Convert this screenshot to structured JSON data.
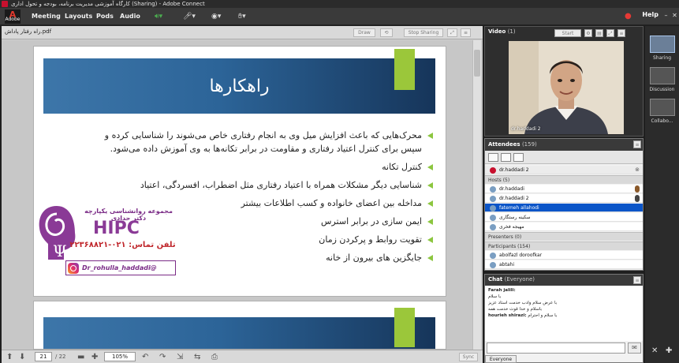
{
  "window": {
    "title": "کارگاه آموزشی مدیریت برنامه، بودجه و تحول اداری (Sharing) - Adobe Connect"
  },
  "menubar": {
    "brand": "Adobe",
    "items": [
      "Meeting",
      "Layouts",
      "Pods",
      "Audio"
    ],
    "help": "Help"
  },
  "share_pod": {
    "document_name": "راه رفتار پاداش.pdf",
    "draw_label": "Draw",
    "stop_sharing_label": "Stop Sharing",
    "page_current": "21",
    "page_total": "/ 22",
    "zoom": "105%",
    "sync_label": "Sync"
  },
  "slide": {
    "title": "راهکارها",
    "bullets": [
      "محرک‌هایی که باعث افزایش میل وی به انجام رفتاری خاص می‌شوند را شناسایی کرده و سپس برای کنترل اعتیاد رفتاری و مقاومت در برابر تکانه‌ها به وی آموزش داده می‌شود.",
      "کنترل تکانه",
      "شناسایی دیگر مشکلات همراه با اعتیاد  رفتاری مثل اضطراب، افسردگی، اعتیاد",
      "مداخله بین اعضای خانواده و کسب اطلاعات بیشتر",
      "ایمن سازی در برابر استرس",
      "تقویت روابط و پرکردن زمان",
      "جایگزین های بیرون از خانه"
    ],
    "logo": {
      "org": "مجموعه روانشناسی یکپارچه دکتر حدادی",
      "acronym": "HIPC",
      "phone": "تلفن تماس: ۰۲۱-۲۲۳۶۸۸۲۱",
      "instagram": "Dr_rohulla_haddadi@"
    }
  },
  "video_pod": {
    "title": "Video",
    "count": "(1)",
    "start_label": "Start",
    "speaker": "dr.haddadi 2"
  },
  "attendees_pod": {
    "title": "Attendees",
    "count": "(159)",
    "current_speaker": "dr.haddadi 2",
    "hosts_label": "Hosts (5)",
    "hosts": [
      "dr.haddadi",
      "dr.haddadi 2",
      "fatemeh allahodi",
      "سکینه رستگاری",
      "مهیجه فخری"
    ],
    "presenters_label": "Presenters (0)",
    "participants_label": "Participants (154)",
    "participants": [
      "abolfazl doroofkar",
      "abtahi"
    ]
  },
  "chat_pod": {
    "title": "Chat",
    "scope": "(Everyone)",
    "messages": [
      {
        "sender": "Farah jalili:",
        "text": ""
      },
      {
        "sender": "",
        "text": "با سلام"
      },
      {
        "sender": "",
        "text": "با عرض سلام وادب خدمت استاد عزیز"
      },
      {
        "sender": "",
        "text": "باسلام و خدا قوت خدمت همه"
      },
      {
        "sender": "hourieh shirazi:",
        "text": "با سلام و احترام"
      }
    ],
    "tab_label": "Everyone"
  },
  "layouts": [
    "Sharing",
    "Discussion",
    "Collabo..."
  ],
  "colors": {
    "accent_green": "#9bc73a",
    "slide_blue": "#2c6498",
    "selected_row": "#0b55c8"
  }
}
